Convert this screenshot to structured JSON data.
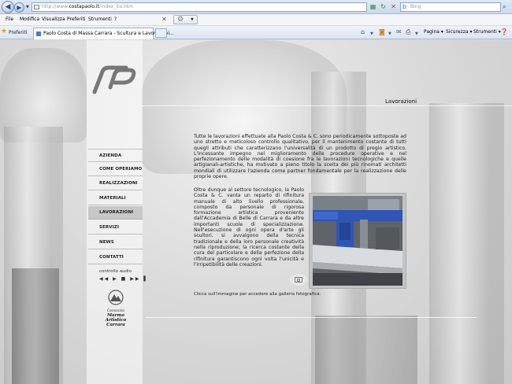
{
  "browser": {
    "url": {
      "scheme": "http://www.",
      "host": "costapaolo.it",
      "path": "/index_ita.htm"
    },
    "search_placeholder": "Bing",
    "menu": [
      "File",
      "Modifica",
      "Visualizza",
      "Preferiti",
      "Strumenti",
      "?"
    ],
    "favorites_label": "Preferiti",
    "tab_title": "Paolo Costa di Massa Carrara - Scultura e Lavorazioni...",
    "commands": {
      "page": "Pagina",
      "security": "Sicurezza",
      "tools": "Strumenti"
    }
  },
  "site": {
    "page_title": "Lavorazioni",
    "nav": [
      "AZIENDA",
      "COME OPERIAMO",
      "REALIZZAZIONI",
      "MATERIALI",
      "LAVORAZIONI",
      "SERVIZI",
      "NEWS",
      "CONTATTI"
    ],
    "active_nav": "LAVORAZIONI",
    "audio": {
      "label": "controllo audio",
      "controls": "◀◀ ▶ ■ ▶▶ ▌"
    },
    "consorzio": {
      "small": "Consorzio",
      "line1": "Marmo Artistico",
      "line2": "Carrara"
    },
    "intro": "Tutte le lavorazioni effettuate alla Paolo Costa & C. sono periodicamente sottoposte ad uno stretto e meticoloso controllo qualitativo, per il mantenimento costante di tutti quegli attributi che caratterizzano l'universalità di un prodotto di pregio artistico. L'incessante impegno nel miglioramento delle procedure operative e nel perfezionamento delle modalità di coesione fra le lavorazioni tecnologiche e quelle artigianali-artistiche, ha motivato a pieno titolo la scelta dei più rinomati architetti mondiali di utilizzare l'azienda come partner fondamentale per la realizzazione delle proprie opere.",
    "body": "Oltre dunque al settore tecnologico, la Paolo Costa & C. vanta un reparto di rifinitura manuale di alto livello professionale, composto da personale di rigorosa formazione artistica proveniente dall'Accademia di Belle di Carrara e da altre importanti scuole di specializzazione. Nell'esecuzione di ogni opera d'arte gli scultori, si avvalgono della tecnica tradizionale e della loro personale creatività nella riproduzione; la ricerca costante della cura del particolare e della perfezione della rifinitura garantiscono ogni volta l'unicità e l'irripetibilità delle creazioni.",
    "gallery_caption": "Clicca sull'immagine per accedere alla galleria fotografica."
  },
  "colors": {
    "accent": "#2a5aa8",
    "machine_blue": "#2f55b5"
  }
}
